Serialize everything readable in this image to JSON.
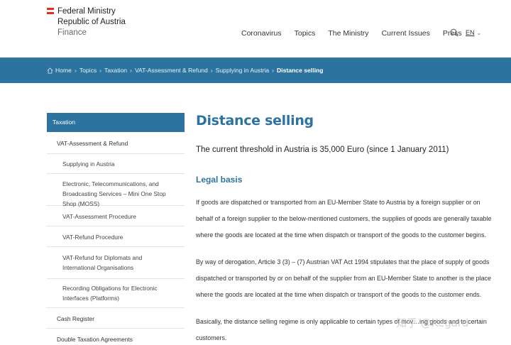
{
  "header": {
    "logo_lines": [
      "Federal Ministry",
      "Republic of Austria",
      "Finance"
    ],
    "nav": [
      "Coronavirus",
      "Topics",
      "The Ministry",
      "Current Issues",
      "Press"
    ],
    "lang": "EN"
  },
  "breadcrumb": {
    "items": [
      "Home",
      "Topics",
      "Taxation",
      "VAT-Assessment & Refund",
      "Supplying in Austria"
    ],
    "current": "Distance selling"
  },
  "sidebar": {
    "head": "Taxation",
    "items": [
      {
        "label": "VAT-Assessment & Refund",
        "level": 2
      },
      {
        "label": "Supplying in Austria",
        "level": 3
      },
      {
        "label": "Electronic, Telecommunications, and Broadcasting Services – Mini One Stop Shop (MOSS)",
        "level": 3
      },
      {
        "label": "VAT-Assessment Procedure",
        "level": 3
      },
      {
        "label": "VAT-Refund Procedure",
        "level": 3
      },
      {
        "label": "VAT-Refund for Diplomats and International Organisations",
        "level": 3
      },
      {
        "label": "Recording Obligations for Electronic Interfaces (Platforms)",
        "level": 3
      },
      {
        "label": "Cash Register",
        "level": 2
      },
      {
        "label": "Double Taxation Agreements",
        "level": 2
      }
    ]
  },
  "main": {
    "title": "Distance selling",
    "threshold": "The current threshold in Austria is 35,000 Euro (since 1 January 2011)",
    "legal_heading": "Legal basis",
    "para1": "If goods are dispatched or transported from an EU-Member State to Austria by a foreign supplier or on behalf of a foreign supplier to the below-mentioned customers, the supplies of goods are generally taxable where the goods are located at the time when dispatch or transport of the goods to the customer begins.",
    "para2": "By way of derogation, Article 3 (3) – (7) Austrian VAT Act 1994 stipulates that the place of supply of goods dispatched or transported by or on behalf of the supplier from an EU-Member State to another is the place where the goods are located at the time when dispatch or transport of the goods to the customer ends.",
    "para3": "Basically, the distance selling regime is only applicable to certain types of mov…ing goods and to certain customers."
  },
  "watermark": "知乎 @Kegard",
  "colors": {
    "accent": "#2d73a0",
    "flag_red": "#e0301e"
  }
}
